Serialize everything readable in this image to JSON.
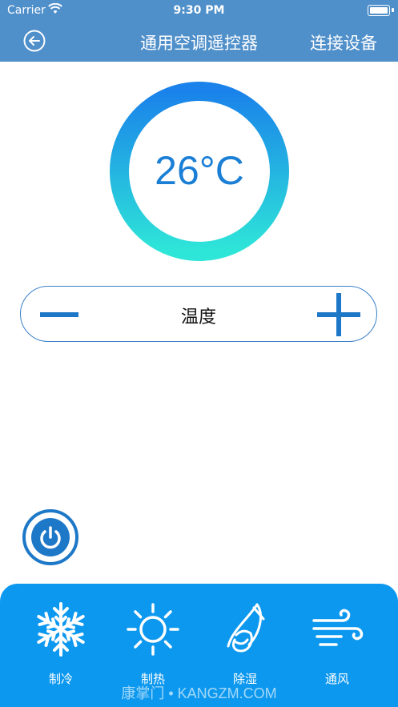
{
  "status_bar": {
    "carrier": "Carrier",
    "time": "9:30 PM"
  },
  "nav": {
    "title": "通用空调遥控器",
    "right_action": "连接设备",
    "back_icon": "back-arrow-icon"
  },
  "thermostat": {
    "temperature": "26°C",
    "ring_gradient": [
      "#1a82ea",
      "#2ee6d8"
    ]
  },
  "temp_control": {
    "label": "温度",
    "minus_icon": "minus-icon",
    "plus_icon": "plus-icon"
  },
  "power": {
    "icon": "power-icon"
  },
  "modes": [
    {
      "label": "制冷",
      "icon": "snowflake-icon"
    },
    {
      "label": "制热",
      "icon": "sun-icon"
    },
    {
      "label": "除湿",
      "icon": "water-drop-icon"
    },
    {
      "label": "通风",
      "icon": "wind-icon"
    }
  ],
  "watermark": "康掌门 • KANGZM.COM",
  "colors": {
    "header": "#4f8fca",
    "mode_bar": "#0d98ef",
    "accent": "#1e78c8"
  }
}
